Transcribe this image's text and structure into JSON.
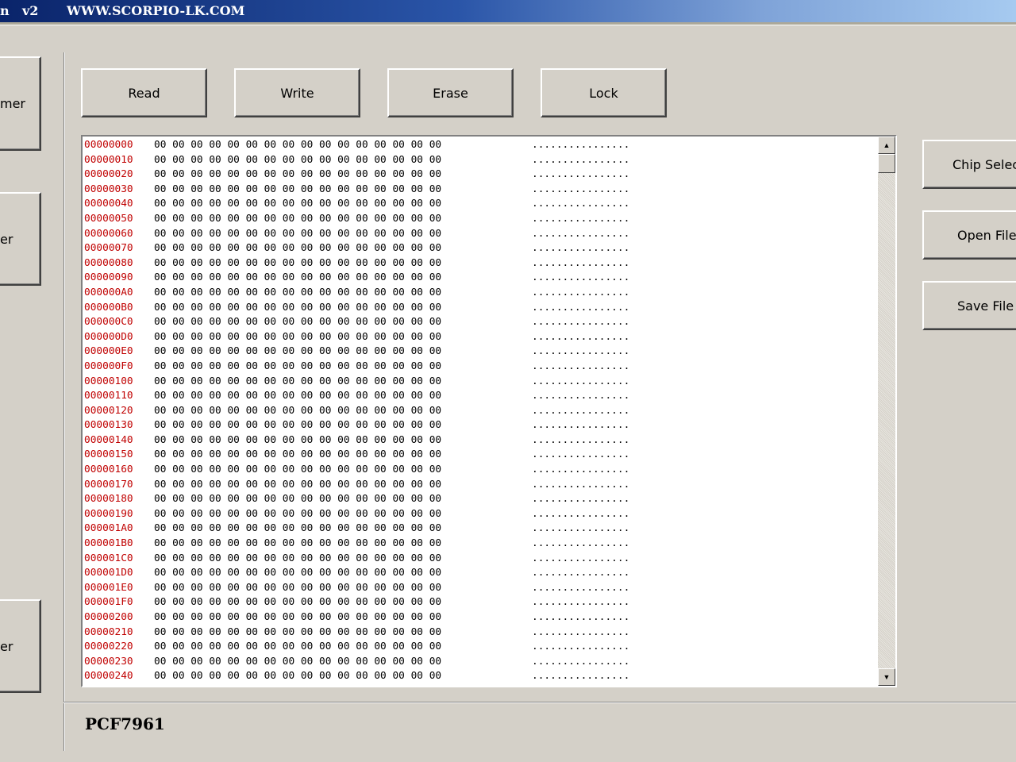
{
  "titlebar": {
    "left_fragment": "n",
    "version": "v2",
    "site": "WWW.SCORPIO-LK.COM"
  },
  "left_buttons": [
    {
      "label": "mer"
    },
    {
      "label": "er"
    },
    {
      "label": "er"
    }
  ],
  "toolbar": {
    "read_label": "Read",
    "write_label": "Write",
    "erase_label": "Erase",
    "lock_label": "Lock"
  },
  "right_buttons": {
    "chip_select_label": "Chip Selec",
    "open_file_label": "Open File",
    "save_file_label": "Save File"
  },
  "hex": {
    "rows": [
      {
        "addr": "00000000",
        "bytes": "00 00 00 00 00 00 00 00 00 00 00 00 00 00 00 00",
        "ascii": "................"
      },
      {
        "addr": "00000010",
        "bytes": "00 00 00 00 00 00 00 00 00 00 00 00 00 00 00 00",
        "ascii": "................"
      },
      {
        "addr": "00000020",
        "bytes": "00 00 00 00 00 00 00 00 00 00 00 00 00 00 00 00",
        "ascii": "................"
      },
      {
        "addr": "00000030",
        "bytes": "00 00 00 00 00 00 00 00 00 00 00 00 00 00 00 00",
        "ascii": "................"
      },
      {
        "addr": "00000040",
        "bytes": "00 00 00 00 00 00 00 00 00 00 00 00 00 00 00 00",
        "ascii": "................"
      },
      {
        "addr": "00000050",
        "bytes": "00 00 00 00 00 00 00 00 00 00 00 00 00 00 00 00",
        "ascii": "................"
      },
      {
        "addr": "00000060",
        "bytes": "00 00 00 00 00 00 00 00 00 00 00 00 00 00 00 00",
        "ascii": "................"
      },
      {
        "addr": "00000070",
        "bytes": "00 00 00 00 00 00 00 00 00 00 00 00 00 00 00 00",
        "ascii": "................"
      },
      {
        "addr": "00000080",
        "bytes": "00 00 00 00 00 00 00 00 00 00 00 00 00 00 00 00",
        "ascii": "................"
      },
      {
        "addr": "00000090",
        "bytes": "00 00 00 00 00 00 00 00 00 00 00 00 00 00 00 00",
        "ascii": "................"
      },
      {
        "addr": "000000A0",
        "bytes": "00 00 00 00 00 00 00 00 00 00 00 00 00 00 00 00",
        "ascii": "................"
      },
      {
        "addr": "000000B0",
        "bytes": "00 00 00 00 00 00 00 00 00 00 00 00 00 00 00 00",
        "ascii": "................"
      },
      {
        "addr": "000000C0",
        "bytes": "00 00 00 00 00 00 00 00 00 00 00 00 00 00 00 00",
        "ascii": "................"
      },
      {
        "addr": "000000D0",
        "bytes": "00 00 00 00 00 00 00 00 00 00 00 00 00 00 00 00",
        "ascii": "................"
      },
      {
        "addr": "000000E0",
        "bytes": "00 00 00 00 00 00 00 00 00 00 00 00 00 00 00 00",
        "ascii": "................"
      },
      {
        "addr": "000000F0",
        "bytes": "00 00 00 00 00 00 00 00 00 00 00 00 00 00 00 00",
        "ascii": "................"
      },
      {
        "addr": "00000100",
        "bytes": "00 00 00 00 00 00 00 00 00 00 00 00 00 00 00 00",
        "ascii": "................"
      },
      {
        "addr": "00000110",
        "bytes": "00 00 00 00 00 00 00 00 00 00 00 00 00 00 00 00",
        "ascii": "................"
      },
      {
        "addr": "00000120",
        "bytes": "00 00 00 00 00 00 00 00 00 00 00 00 00 00 00 00",
        "ascii": "................"
      },
      {
        "addr": "00000130",
        "bytes": "00 00 00 00 00 00 00 00 00 00 00 00 00 00 00 00",
        "ascii": "................"
      },
      {
        "addr": "00000140",
        "bytes": "00 00 00 00 00 00 00 00 00 00 00 00 00 00 00 00",
        "ascii": "................"
      },
      {
        "addr": "00000150",
        "bytes": "00 00 00 00 00 00 00 00 00 00 00 00 00 00 00 00",
        "ascii": "................"
      },
      {
        "addr": "00000160",
        "bytes": "00 00 00 00 00 00 00 00 00 00 00 00 00 00 00 00",
        "ascii": "................"
      },
      {
        "addr": "00000170",
        "bytes": "00 00 00 00 00 00 00 00 00 00 00 00 00 00 00 00",
        "ascii": "................"
      },
      {
        "addr": "00000180",
        "bytes": "00 00 00 00 00 00 00 00 00 00 00 00 00 00 00 00",
        "ascii": "................"
      },
      {
        "addr": "00000190",
        "bytes": "00 00 00 00 00 00 00 00 00 00 00 00 00 00 00 00",
        "ascii": "................"
      },
      {
        "addr": "000001A0",
        "bytes": "00 00 00 00 00 00 00 00 00 00 00 00 00 00 00 00",
        "ascii": "................"
      },
      {
        "addr": "000001B0",
        "bytes": "00 00 00 00 00 00 00 00 00 00 00 00 00 00 00 00",
        "ascii": "................"
      },
      {
        "addr": "000001C0",
        "bytes": "00 00 00 00 00 00 00 00 00 00 00 00 00 00 00 00",
        "ascii": "................"
      },
      {
        "addr": "000001D0",
        "bytes": "00 00 00 00 00 00 00 00 00 00 00 00 00 00 00 00",
        "ascii": "................"
      },
      {
        "addr": "000001E0",
        "bytes": "00 00 00 00 00 00 00 00 00 00 00 00 00 00 00 00",
        "ascii": "................"
      },
      {
        "addr": "000001F0",
        "bytes": "00 00 00 00 00 00 00 00 00 00 00 00 00 00 00 00",
        "ascii": "................"
      },
      {
        "addr": "00000200",
        "bytes": "00 00 00 00 00 00 00 00 00 00 00 00 00 00 00 00",
        "ascii": "................"
      },
      {
        "addr": "00000210",
        "bytes": "00 00 00 00 00 00 00 00 00 00 00 00 00 00 00 00",
        "ascii": "................"
      },
      {
        "addr": "00000220",
        "bytes": "00 00 00 00 00 00 00 00 00 00 00 00 00 00 00 00",
        "ascii": "................"
      },
      {
        "addr": "00000230",
        "bytes": "00 00 00 00 00 00 00 00 00 00 00 00 00 00 00 00",
        "ascii": "................"
      },
      {
        "addr": "00000240",
        "bytes": "00 00 00 00 00 00 00 00 00 00 00 00 00 00 00 00",
        "ascii": "................"
      }
    ]
  },
  "status": {
    "chip_name": "PCF7961"
  },
  "colors": {
    "address": "#c00000",
    "window_bg": "#d4d0c8",
    "title_start": "#0a246a",
    "title_end": "#a6caf0"
  },
  "icons": {
    "scroll_up": "arrow-up-icon",
    "scroll_down": "arrow-down-icon"
  }
}
